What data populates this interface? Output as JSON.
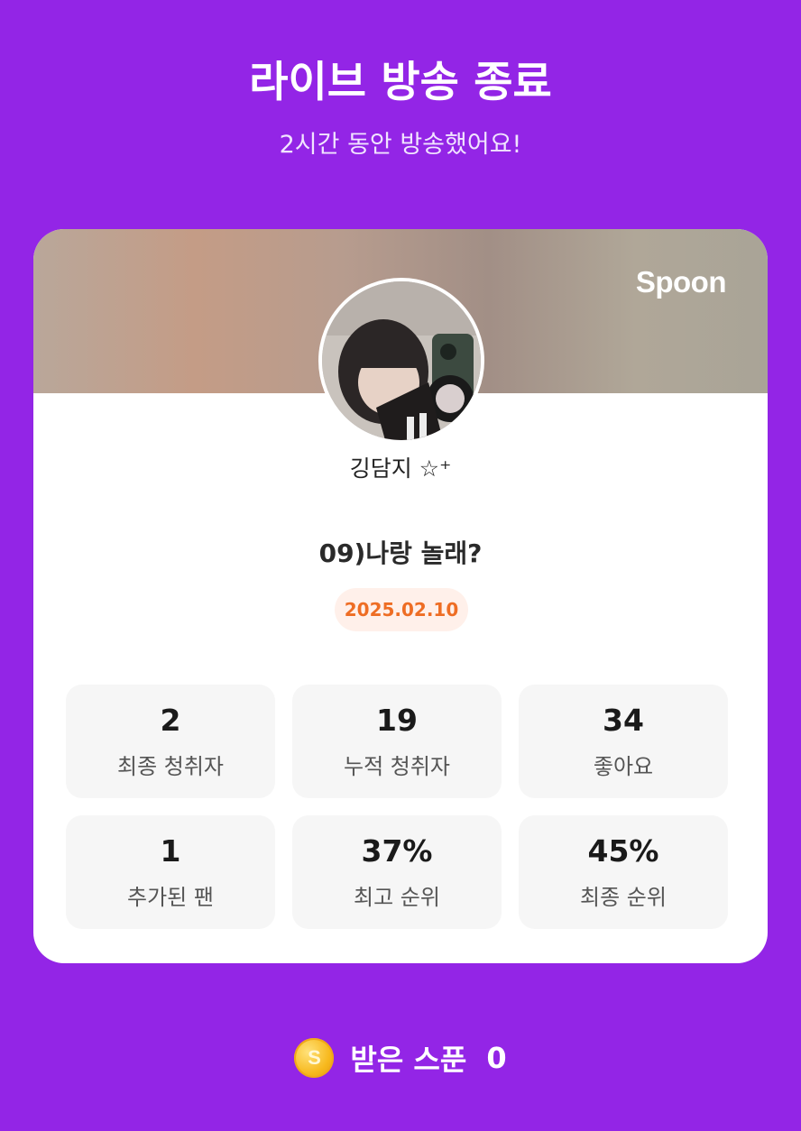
{
  "header": {
    "title": "라이브 방송 종료",
    "subtitle": "2시간 동안 방송했어요!"
  },
  "card": {
    "brand": "Spoon",
    "nickname": "깅담지 ☆⁺",
    "live_title": "09)나랑 놀래?",
    "date": "2025.02.10",
    "stats": [
      {
        "value": "2",
        "label": "최종 청취자"
      },
      {
        "value": "19",
        "label": "누적 청취자"
      },
      {
        "value": "34",
        "label": "좋아요"
      },
      {
        "value": "1",
        "label": "추가된 팬"
      },
      {
        "value": "37%",
        "label": "최고 순위"
      },
      {
        "value": "45%",
        "label": "최종 순위"
      }
    ]
  },
  "footer": {
    "coin_symbol": "S",
    "spoon_label": "받은 스푼",
    "spoon_count": "0"
  },
  "colors": {
    "background": "#9325e6",
    "date_accent": "#ee6d24",
    "coin": "#f7b81d"
  }
}
